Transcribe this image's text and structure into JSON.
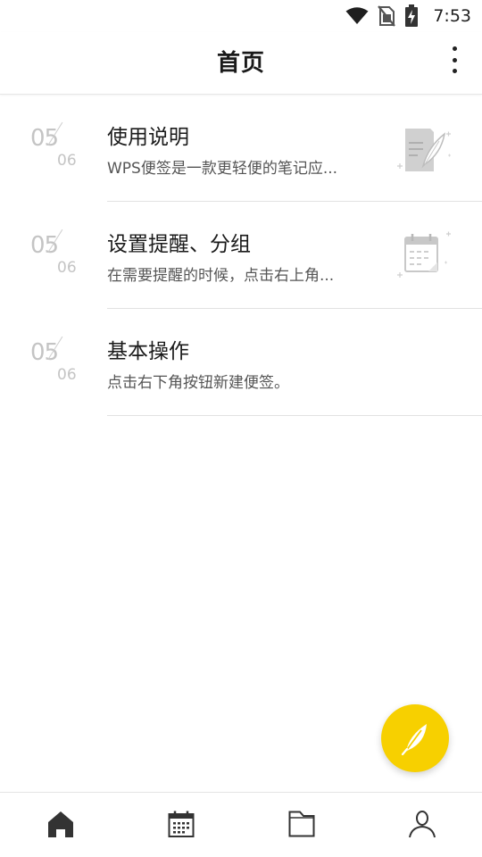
{
  "status_bar": {
    "time": "7:53",
    "icons": [
      "wifi-icon",
      "no-sim-icon",
      "battery-charging-icon"
    ]
  },
  "header": {
    "title": "首页",
    "more_icon": "more-vertical-icon"
  },
  "notes": [
    {
      "month": "05",
      "day": "06",
      "title": "使用说明",
      "snippet": "WPS便签是一款更轻便的笔记应...",
      "thumbnail": "note-feather-icon"
    },
    {
      "month": "05",
      "day": "06",
      "title": "设置提醒、分组",
      "snippet": "在需要提醒的时候，点击右上角...",
      "thumbnail": "calendar-note-icon"
    },
    {
      "month": "05",
      "day": "06",
      "title": "基本操作",
      "snippet": "点击右下角按钮新建便签。",
      "thumbnail": ""
    }
  ],
  "fab": {
    "icon": "feather-icon",
    "color": "#f7d000"
  },
  "bottom_nav": [
    {
      "icon": "home-icon",
      "active": true
    },
    {
      "icon": "calendar-icon",
      "active": false
    },
    {
      "icon": "folder-icon",
      "active": false
    },
    {
      "icon": "user-icon",
      "active": false
    }
  ],
  "colors": {
    "accent": "#f7d000",
    "date_text": "#c4c4c4",
    "divider": "#e2e2e2"
  }
}
